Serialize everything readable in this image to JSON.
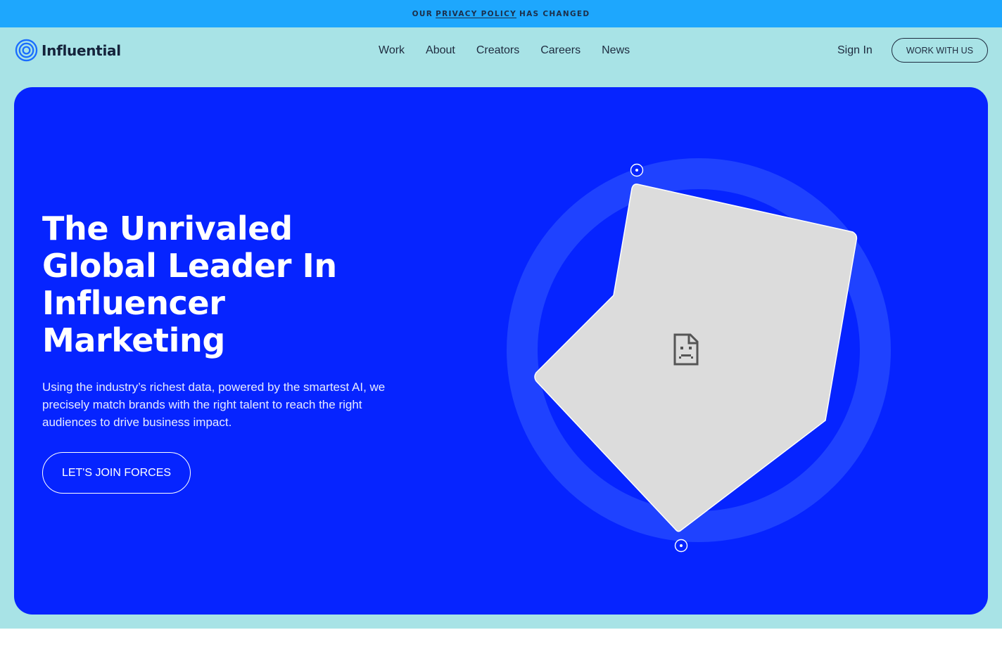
{
  "announcement": {
    "prefix": "OUR",
    "link": "PRIVACY POLICY",
    "suffix": "HAS CHANGED"
  },
  "brand": {
    "name": "Influential",
    "logo_icon": "concentric-circles-icon"
  },
  "nav": {
    "items": [
      {
        "label": "Work"
      },
      {
        "label": "About"
      },
      {
        "label": "Creators"
      },
      {
        "label": "Careers"
      },
      {
        "label": "News"
      }
    ],
    "sign_in": "Sign In",
    "work_with_us": "WORK WITH US"
  },
  "hero": {
    "headline_lines": [
      "The Unrivaled",
      "Global Leader In",
      "Influencer",
      "Marketing"
    ],
    "subtext": "Using the industry’s richest data, powered by the smartest AI, we precisely match brands with the right talent to reach the right audiences to drive business impact.",
    "cta": "LET'S JOIN FORCES",
    "broken_image_icon": "broken-image-icon"
  },
  "colors": {
    "announcement_bg": "#1ea7fd",
    "page_bg": "#a8e3e6",
    "hero_bg": "#0624ff",
    "ring": "#1f42ff",
    "image_placeholder": "#dcdcdc",
    "text_dark": "#1e2b3f"
  }
}
